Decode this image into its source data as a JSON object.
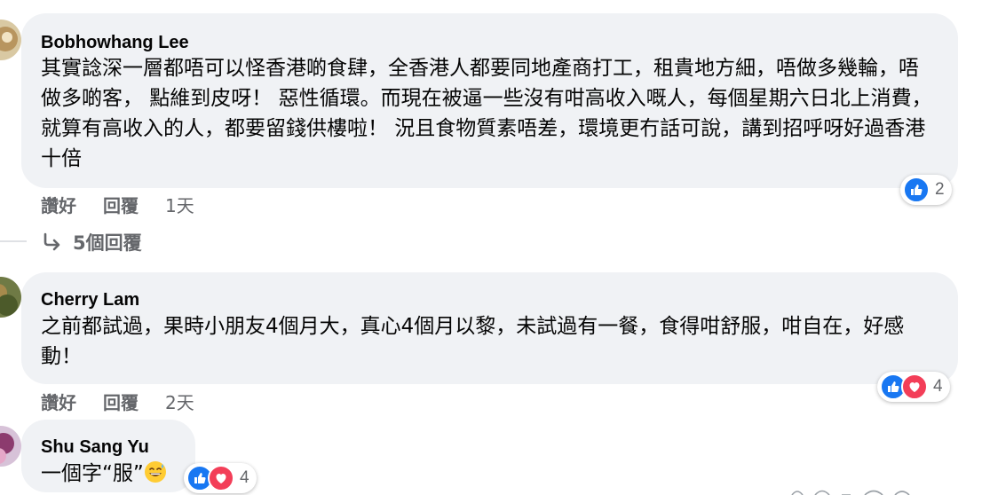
{
  "comments": [
    {
      "author": "Bobhowhang Lee",
      "text": "其實諗深一層都唔可以怪香港啲食肆，全香港人都要同地產商打工，租貴地方細，唔做多幾輪，唔做多啲客， 點維到皮呀！ 惡性循環。而現在被逼一些沒有咁高收入嘅人，每個星期六日北上消費，就算有高收入的人，都要留錢供樓啦！ 況且食物質素唔差，環境更冇話可說，講到招呼呀好過香港十倍",
      "like_label": "讚好",
      "reply_label": "回覆",
      "time": "1天",
      "reaction_count": "2",
      "reactions": [
        "like"
      ],
      "replies_label": "5個回覆"
    },
    {
      "author": "Cherry Lam",
      "text": "之前都試過，果時小朋友4個月大，真心4個月以黎，未試過有一餐，食得咁舒服，咁自在，好感動！",
      "like_label": "讚好",
      "reply_label": "回覆",
      "time": "2天",
      "reaction_count": "4",
      "reactions": [
        "like",
        "love"
      ]
    },
    {
      "author": "Shu Sang Yu",
      "text": "一個字“服”",
      "emoji": "grinning-sweat-emoji",
      "reaction_count": "4",
      "reactions": [
        "like",
        "love"
      ]
    }
  ],
  "colors": {
    "bubble": "#f0f2f5",
    "secondary_text": "#65676b",
    "like_blue": "#1877f2",
    "love_red": "#f33e58"
  }
}
